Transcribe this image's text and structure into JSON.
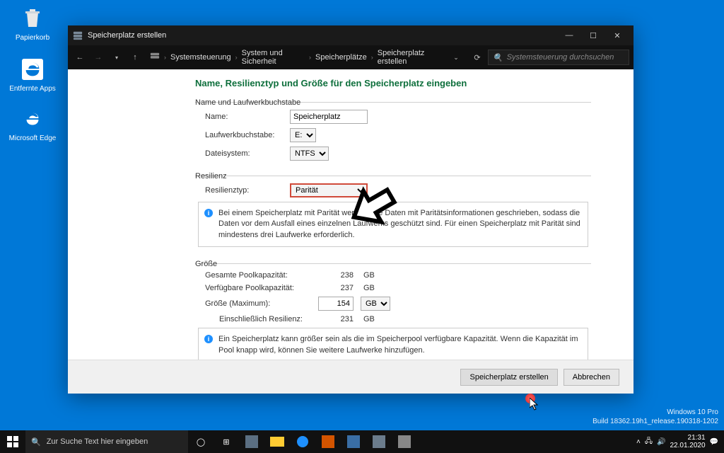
{
  "desktop": {
    "icons": [
      "Papierkorb",
      "Entfernte Apps",
      "Microsoft Edge"
    ]
  },
  "window": {
    "title": "Speicherplatz erstellen",
    "breadcrumb": [
      "Systemsteuerung",
      "System und Sicherheit",
      "Speicherplätze",
      "Speicherplatz erstellen"
    ],
    "search_placeholder": "Systemsteuerung durchsuchen"
  },
  "page": {
    "title": "Name, Resilienztyp und Größe für den Speicherplatz eingeben",
    "section_name": {
      "legend": "Name und Laufwerkbuchstabe",
      "name_label": "Name:",
      "name_value": "Speicherplatz",
      "drive_label": "Laufwerkbuchstabe:",
      "drive_value": "E:",
      "fs_label": "Dateisystem:",
      "fs_value": "NTFS"
    },
    "section_resil": {
      "legend": "Resilienz",
      "type_label": "Resilienztyp:",
      "type_value": "Parität",
      "info": "Bei einem Speicherplatz mit Parität werden Ihre Daten mit Paritätsinformationen geschrieben, sodass die Daten vor dem Ausfall eines einzelnen Laufwerks geschützt sind. Für einen Speicherplatz mit Parität sind mindestens drei Laufwerke erforderlich."
    },
    "section_size": {
      "legend": "Größe",
      "total_label": "Gesamte Poolkapazität:",
      "total_value": "238",
      "total_unit": "GB",
      "avail_label": "Verfügbare Poolkapazität:",
      "avail_value": "237",
      "avail_unit": "GB",
      "size_label": "Größe (Maximum):",
      "size_value": "154",
      "size_unit": "GB",
      "incl_label": "Einschließlich Resilienz:",
      "incl_value": "231",
      "incl_unit": "GB",
      "info": "Ein Speicherplatz kann größer sein als die im Speicherpool verfügbare Kapazität. Wenn die Kapazität im Pool knapp wird, können Sie weitere Laufwerke hinzufügen."
    },
    "buttons": {
      "create": "Speicherplatz erstellen",
      "cancel": "Abbrechen"
    }
  },
  "taskbar": {
    "search_placeholder": "Zur Suche Text hier eingeben"
  },
  "watermark": {
    "line1": "Windows 10 Pro",
    "line2": "Build 18362.19h1_release.190318-1202"
  },
  "tray": {
    "time": "21:31",
    "date": "22.01.2020"
  }
}
